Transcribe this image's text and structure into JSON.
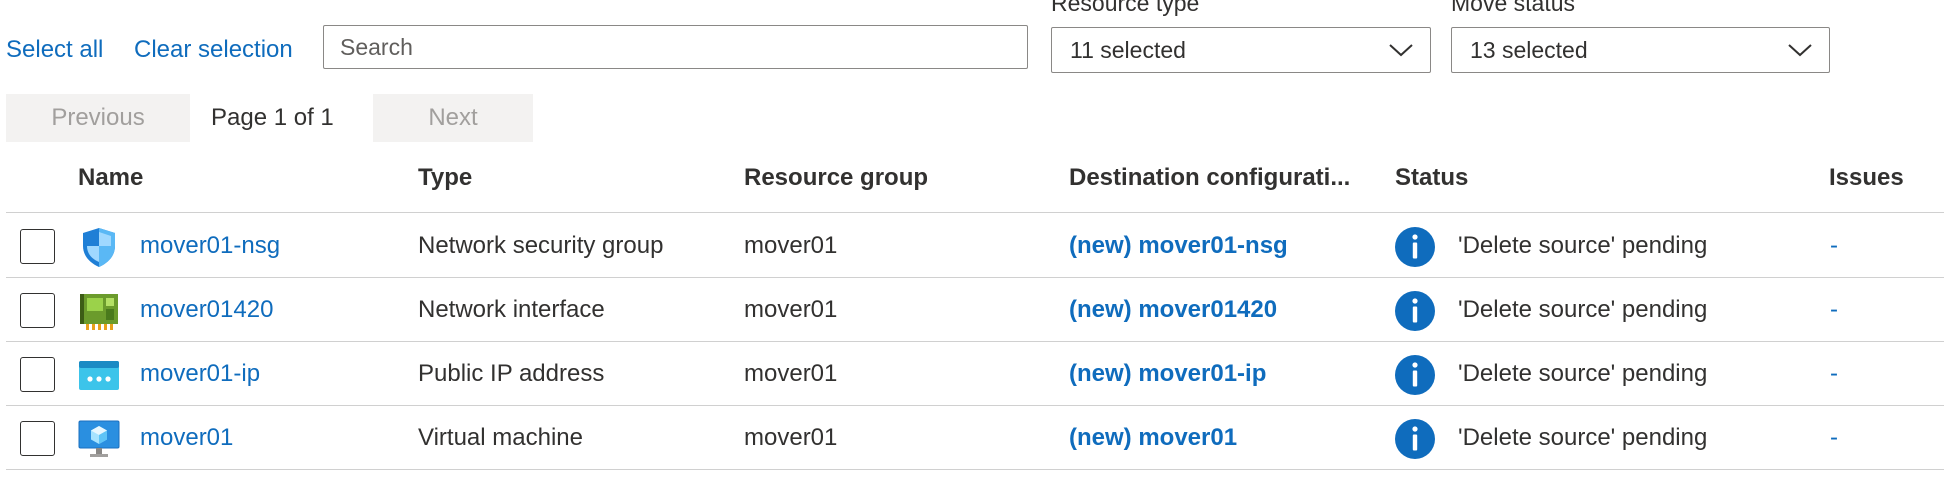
{
  "toolbar": {
    "select_all": "Select all",
    "clear_selection": "Clear selection",
    "search_placeholder": "Search"
  },
  "filters": {
    "resource_type": {
      "label": "Resource type",
      "value": "11 selected"
    },
    "move_status": {
      "label": "Move status",
      "value": "13 selected"
    }
  },
  "pagination": {
    "previous": "Previous",
    "page_text": "Page 1 of 1",
    "next": "Next"
  },
  "table": {
    "headers": {
      "name": "Name",
      "type": "Type",
      "resource_group": "Resource group",
      "destination": "Destination configurati...",
      "status": "Status",
      "issues": "Issues"
    },
    "rows": [
      {
        "icon": "network-security-group-icon",
        "name": "mover01-nsg",
        "type": "Network security group",
        "resource_group": "mover01",
        "destination": "(new) mover01-nsg",
        "status": "'Delete source' pending",
        "issues": "-"
      },
      {
        "icon": "network-interface-icon",
        "name": "mover01420",
        "type": "Network interface",
        "resource_group": "mover01",
        "destination": "(new) mover01420",
        "status": "'Delete source' pending",
        "issues": "-"
      },
      {
        "icon": "public-ip-address-icon",
        "name": "mover01-ip",
        "type": "Public IP address",
        "resource_group": "mover01",
        "destination": "(new) mover01-ip",
        "status": "'Delete source' pending",
        "issues": "-"
      },
      {
        "icon": "virtual-machine-icon",
        "name": "mover01",
        "type": "Virtual machine",
        "resource_group": "mover01",
        "destination": "(new) mover01",
        "status": "'Delete source' pending",
        "issues": "-"
      }
    ]
  },
  "colors": {
    "link": "#0f6cbd",
    "info": "#0f6cbd"
  }
}
